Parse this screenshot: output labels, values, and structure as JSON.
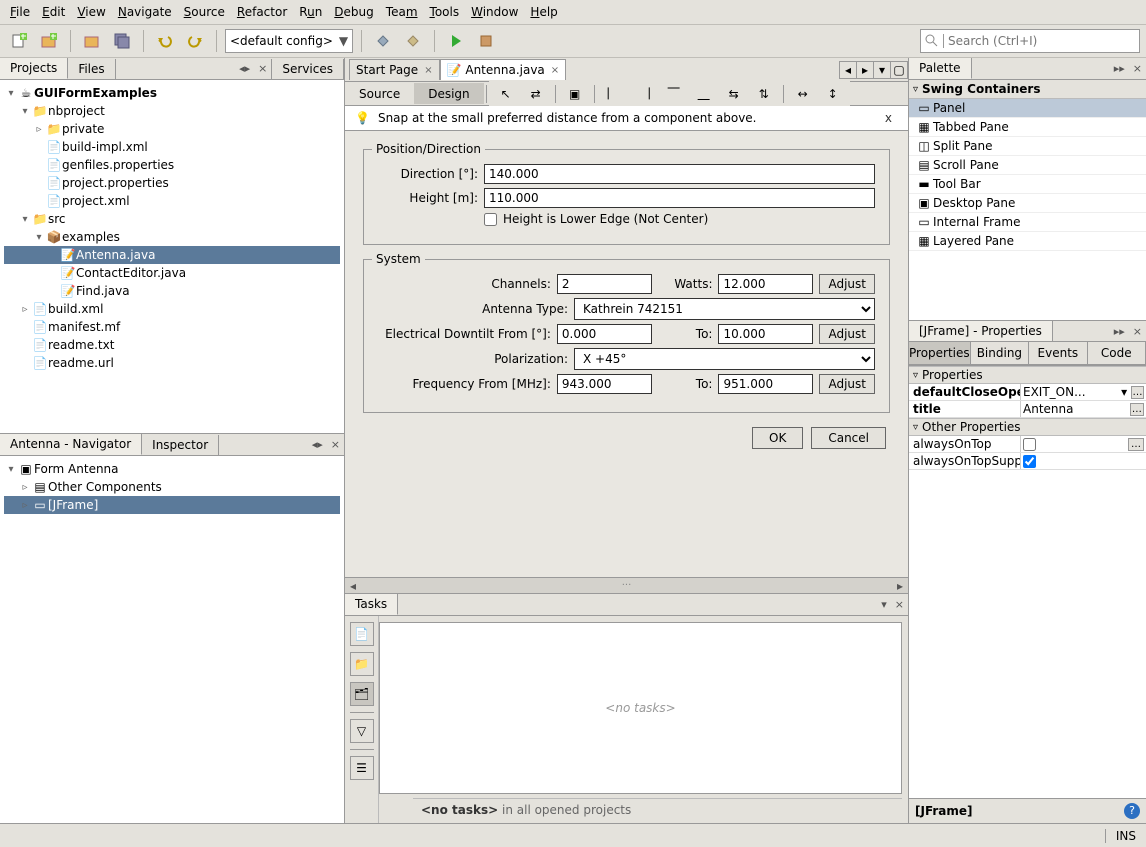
{
  "menus": [
    "File",
    "Edit",
    "View",
    "Navigate",
    "Source",
    "Refactor",
    "Run",
    "Debug",
    "Team",
    "Tools",
    "Window",
    "Help"
  ],
  "config_combo": "<default config>",
  "search_placeholder": "Search (Ctrl+I)",
  "left_tabs": {
    "projects": "Projects",
    "files": "Files",
    "services": "Services"
  },
  "project_tree": {
    "root": "GUIFormExamples",
    "nbproject": "nbproject",
    "private": "private",
    "build_impl": "build-impl.xml",
    "genfiles": "genfiles.properties",
    "project_props": "project.properties",
    "project_xml": "project.xml",
    "src": "src",
    "examples": "examples",
    "antenna": "Antenna.java",
    "contact": "ContactEditor.java",
    "find": "Find.java",
    "build_xml": "build.xml",
    "manifest": "manifest.mf",
    "readme_txt": "readme.txt",
    "readme_url": "readme.url"
  },
  "navigator": {
    "title": "Antenna - Navigator",
    "inspector": "Inspector",
    "form": "Form Antenna",
    "other": "Other Components",
    "jframe": "[JFrame]"
  },
  "editor_tabs": {
    "start": "Start Page",
    "antenna": "Antenna.java"
  },
  "source_design": {
    "source": "Source",
    "design": "Design"
  },
  "hint": "Snap at the small preferred distance from a component above.",
  "form": {
    "group1": "Position/Direction",
    "direction_label": "Direction [°]:",
    "direction_value": "140.000",
    "height_label": "Height [m]:",
    "height_value": "110.000",
    "height_check": "Height is Lower Edge (Not Center)",
    "group2": "System",
    "channels_label": "Channels:",
    "channels_value": "2",
    "watts_label": "Watts:",
    "watts_value": "12.000",
    "adjust": "Adjust",
    "ant_type_label": "Antenna Type:",
    "ant_type_value": "Kathrein 742151",
    "edt_label": "Electrical Downtilt From [°]:",
    "edt_from": "0.000",
    "edt_to_label": "To:",
    "edt_to": "10.000",
    "polar_label": "Polarization:",
    "polar_value": "X +45°",
    "freq_label": "Frequency From [MHz]:",
    "freq_from": "943.000",
    "freq_to_label": "To:",
    "freq_to": "951.000",
    "ok": "OK",
    "cancel": "Cancel"
  },
  "palette": {
    "title": "Palette",
    "cat": "Swing Containers",
    "items": [
      "Panel",
      "Tabbed Pane",
      "Split Pane",
      "Scroll Pane",
      "Tool Bar",
      "Desktop Pane",
      "Internal Frame",
      "Layered Pane"
    ]
  },
  "properties": {
    "title": "[JFrame] - Properties",
    "tabs": {
      "properties": "Properties",
      "binding": "Binding",
      "events": "Events",
      "code": "Code"
    },
    "section_props": "Properties",
    "rows": {
      "defaultClose": {
        "name": "defaultCloseOperation",
        "value": "EXIT_ON..."
      },
      "title": {
        "name": "title",
        "value": "Antenna"
      }
    },
    "section_other": "Other Properties",
    "other_rows": {
      "alwaysOnTop": {
        "name": "alwaysOnTop"
      },
      "alwaysOnTopSup": {
        "name": "alwaysOnTopSupported"
      }
    },
    "footer": "[JFrame]"
  },
  "tasks": {
    "title": "Tasks",
    "empty": "<no tasks>",
    "footer_bold": "<no tasks>",
    "footer_rest": " in all opened projects"
  },
  "statusbar": {
    "ins": "INS"
  }
}
